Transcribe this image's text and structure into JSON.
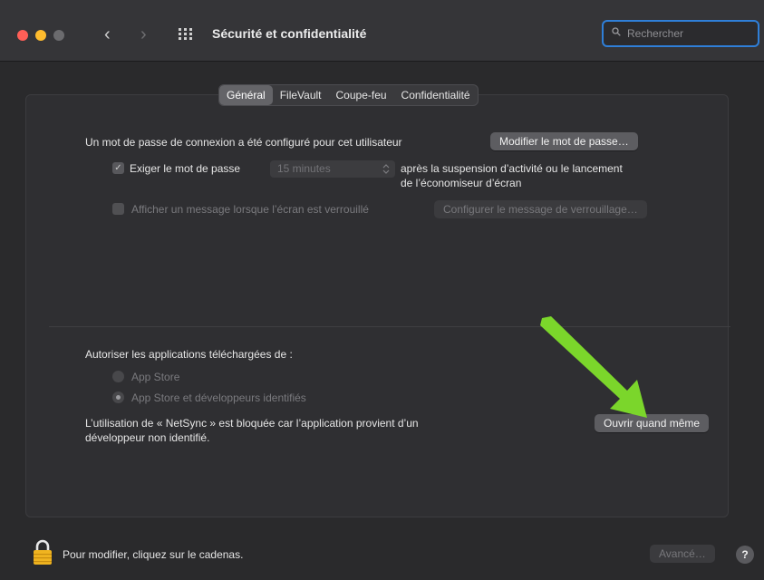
{
  "window": {
    "title": "Sécurité et confidentialité",
    "search_placeholder": "Rechercher"
  },
  "tabs": [
    {
      "label": "Général",
      "active": true
    },
    {
      "label": "FileVault",
      "active": false
    },
    {
      "label": "Coupe-feu",
      "active": false
    },
    {
      "label": "Confidentialité",
      "active": false
    }
  ],
  "general": {
    "password_notice": "Un mot de passe de connexion a été configuré pour cet utilisateur",
    "change_password_button": "Modifier le mot de passe…",
    "require_password_label": "Exiger le mot de passe",
    "require_password_checked": true,
    "require_password_delay": "15 minutes",
    "require_password_suffix_line1": "après la suspension d’activité ou le lancement",
    "require_password_suffix_line2": "de l’économiseur d’écran",
    "lock_message_label": "Afficher un message lorsque l’écran est verrouillé",
    "lock_message_checked": false,
    "lock_message_button": "Configurer le message de verrouillage…"
  },
  "downloads": {
    "heading": "Autoriser les applications téléchargées de :",
    "options": [
      {
        "label": "App Store",
        "selected": false
      },
      {
        "label": "App Store et développeurs identifiés",
        "selected": true
      }
    ],
    "blocked_line1": "L’utilisation de « NetSync » est bloquée car l’application provient d’un",
    "blocked_line2": "développeur non identifié.",
    "open_anyway_button": "Ouvrir quand même"
  },
  "footer": {
    "lock_text": "Pour modifier, cliquez sur le cadenas.",
    "advanced_button": "Avancé…",
    "help_label": "?"
  },
  "colors": {
    "accent_focus": "#2f7fd8",
    "annotation_arrow": "#7bd62b"
  }
}
